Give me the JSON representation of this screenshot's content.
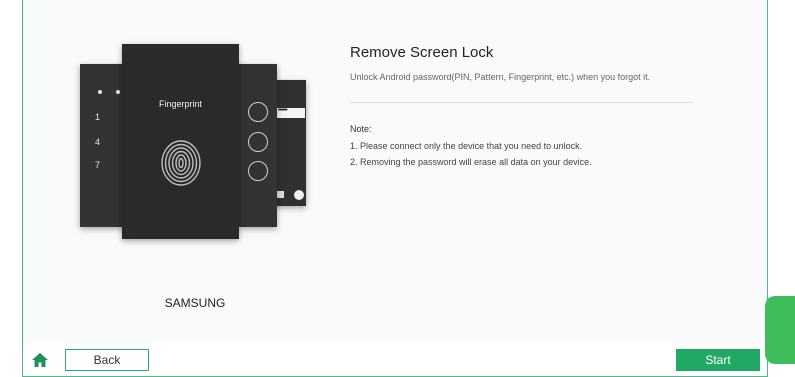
{
  "illustration": {
    "brand": "SAMSUNG",
    "fingerprint_label": "Fingerprint",
    "pin_digits": [
      "1",
      "4",
      "7"
    ],
    "password_mask": "••••••"
  },
  "content": {
    "title": "Remove Screen Lock",
    "subtitle": "Unlock Android password(PIN, Pattern, Fingerprint, etc.) when you forgot it.",
    "note_title": "Note:",
    "notes": [
      "1. Please connect only the device that you need to unlock.",
      "2. Removing the password will erase all data on your device."
    ]
  },
  "footer": {
    "back_label": "Back",
    "start_label": "Start"
  },
  "colors": {
    "accent": "#21a865",
    "border": "#4fb88f",
    "side_tab": "#3fbd5a"
  },
  "icons": {
    "home": "home-icon",
    "fingerprint": "fingerprint-icon"
  }
}
